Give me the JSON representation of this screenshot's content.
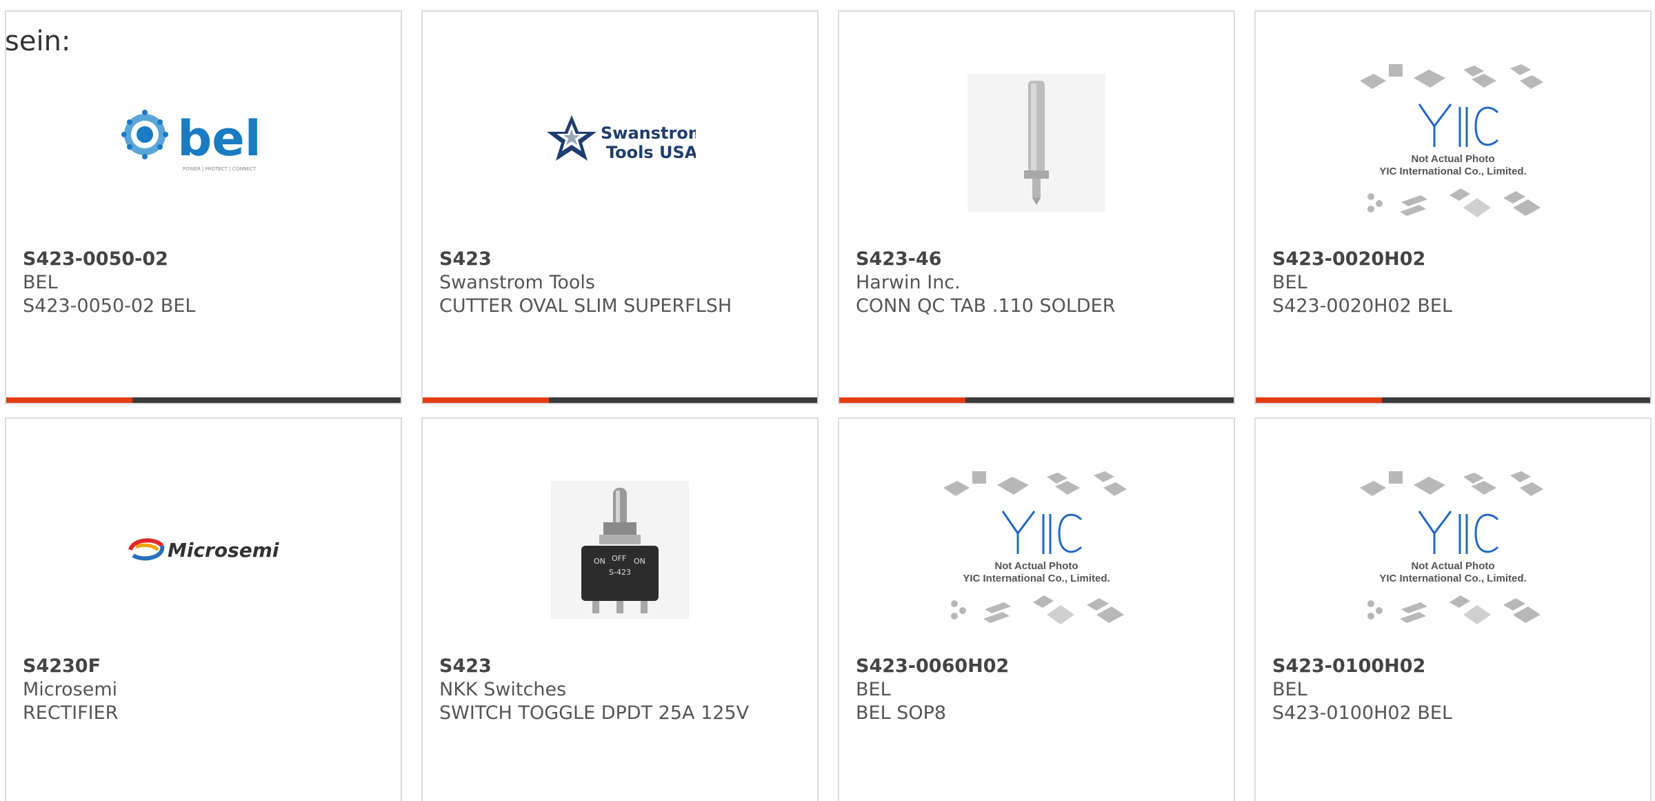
{
  "intro": {
    "text": "sein:"
  },
  "colors": {
    "accent": "#e23d12",
    "bar": "#3b3b3b",
    "border": "#dcdcdc"
  },
  "products": [
    {
      "pn": "S423-0050-02",
      "mfr": "BEL",
      "desc": "S423-0050-02 BEL",
      "image": "bel-logo",
      "logo_text": "bel",
      "logo_tagline": "POWER | PROTECT | CONNECT"
    },
    {
      "pn": "S423",
      "mfr": "Swanstrom Tools",
      "desc": "CUTTER OVAL SLIM SUPERFLSH",
      "image": "swanstrom-logo",
      "logo_text": "Swanstrom",
      "logo_text2": "Tools USA"
    },
    {
      "pn": "S423-46",
      "mfr": "Harwin Inc.",
      "desc": "CONN QC TAB .110 SOLDER",
      "image": "connector-tab-photo"
    },
    {
      "pn": "S423-0020H02",
      "mfr": "BEL",
      "desc": "S423-0020H02 BEL",
      "image": "yic-placeholder",
      "ph_line1": "Not Actual Photo",
      "ph_line2": "YIC International Co., Limited."
    },
    {
      "pn": "S4230F",
      "mfr": "Microsemi",
      "desc": "RECTIFIER",
      "image": "microsemi-logo",
      "logo_text": "Microsemi"
    },
    {
      "pn": "S423",
      "mfr": "NKK Switches",
      "desc": "SWITCH TOGGLE DPDT 25A 125V",
      "image": "toggle-switch-photo",
      "sw_on1": "ON",
      "sw_off": "OFF",
      "sw_on2": "ON",
      "sw_model": "S-423"
    },
    {
      "pn": "S423-0060H02",
      "mfr": "BEL",
      "desc": "BEL SOP8",
      "image": "yic-placeholder",
      "ph_line1": "Not Actual Photo",
      "ph_line2": "YIC International Co., Limited."
    },
    {
      "pn": "S423-0100H02",
      "mfr": "BEL",
      "desc": "S423-0100H02 BEL",
      "image": "yic-placeholder",
      "ph_line1": "Not Actual Photo",
      "ph_line2": "YIC International Co., Limited."
    }
  ]
}
